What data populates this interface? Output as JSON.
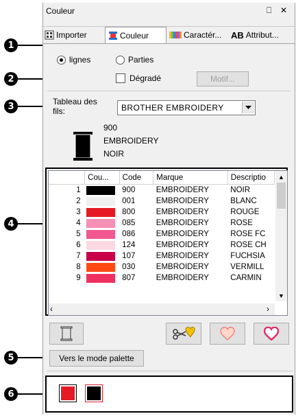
{
  "panel": {
    "title": "Couleur",
    "pin_glyph": "⎕",
    "close_glyph": "✕"
  },
  "tabs": [
    {
      "label": "Importer",
      "icon": "import-icon"
    },
    {
      "label": "Couleur",
      "icon": "color-icon"
    },
    {
      "label": "Caractér...",
      "icon": "character-icon"
    },
    {
      "label": "Attribut...",
      "icon": "attribute-icon",
      "prefix": "AB"
    }
  ],
  "mode": {
    "option_lines": "lignes",
    "option_parts": "Parties",
    "selected": "lignes"
  },
  "gradient": {
    "label": "Dégradé",
    "checked": false,
    "motif_button": "Motif..."
  },
  "thread_table": {
    "label_line1": "Tableau des",
    "label_line2": "fils:",
    "selected": "BROTHER EMBROIDERY"
  },
  "current_thread": {
    "code": "900",
    "brand": "EMBROIDERY",
    "name": "NOIR",
    "color": "#000000"
  },
  "thread_grid": {
    "columns": [
      "",
      "Cou...",
      "Code",
      "Marque",
      "Descriptio"
    ],
    "rows": [
      {
        "n": "1",
        "color": "#000000",
        "code": "900",
        "brand": "EMBROIDERY",
        "desc": "NOIR"
      },
      {
        "n": "2",
        "color": "#f0f0f0",
        "code": "001",
        "brand": "EMBROIDERY",
        "desc": "BLANC"
      },
      {
        "n": "3",
        "color": "#e51a24",
        "code": "800",
        "brand": "EMBROIDERY",
        "desc": "ROUGE"
      },
      {
        "n": "4",
        "color": "#f58fb4",
        "code": "085",
        "brand": "EMBROIDERY",
        "desc": "ROSE"
      },
      {
        "n": "5",
        "color": "#f0588f",
        "code": "086",
        "brand": "EMBROIDERY",
        "desc": "ROSE FC"
      },
      {
        "n": "6",
        "color": "#fbd9e3",
        "code": "124",
        "brand": "EMBROIDERY",
        "desc": "ROSE CH"
      },
      {
        "n": "7",
        "color": "#c8004a",
        "code": "107",
        "brand": "EMBROIDERY",
        "desc": "FUCHSIA"
      },
      {
        "n": "8",
        "color": "#ff4a14",
        "code": "030",
        "brand": "EMBROIDERY",
        "desc": "VERMILL"
      },
      {
        "n": "9",
        "color": "#ee3060",
        "code": "807",
        "brand": "EMBROIDERY",
        "desc": "CARMIN"
      }
    ]
  },
  "palette_mode_button": "Vers le mode palette",
  "used_colors": [
    "#e51a24",
    "#000000"
  ],
  "callouts": [
    "1",
    "2",
    "3",
    "4",
    "5",
    "6"
  ]
}
